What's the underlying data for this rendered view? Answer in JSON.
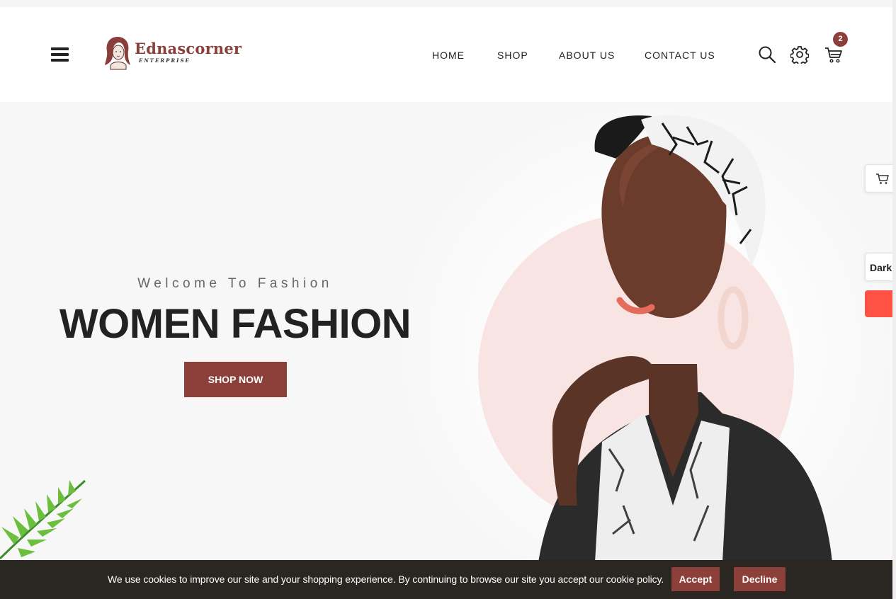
{
  "brand": {
    "name": "Ednascorner",
    "tagline": "ENTERPRISE"
  },
  "nav": {
    "items": [
      {
        "label": "HOME"
      },
      {
        "label": "SHOP"
      },
      {
        "label": "ABOUT US"
      },
      {
        "label": "CONTACT US"
      }
    ]
  },
  "header_icons": {
    "menu": "hamburger-menu-icon",
    "search": "search-icon",
    "settings": "gear-icon",
    "cart": "cart-icon",
    "cart_count": "2"
  },
  "hero": {
    "subtitle": "Welcome To Fashion",
    "title": "WOMEN FASHION",
    "cta_label": "SHOP NOW"
  },
  "side_widgets": {
    "cart_icon": "cart-icon",
    "theme_label": "Dark"
  },
  "cookie_banner": {
    "message": "We use cookies to improve our site and your shopping experience. By continuing to browse our site you accept our cookie policy.",
    "accept_label": "Accept",
    "decline_label": "Decline"
  },
  "colors": {
    "brand": "#8c4039",
    "accent_red": "#ff5144",
    "banner_bg": "#2a2723",
    "hero_circle": "#f7e4e3"
  }
}
